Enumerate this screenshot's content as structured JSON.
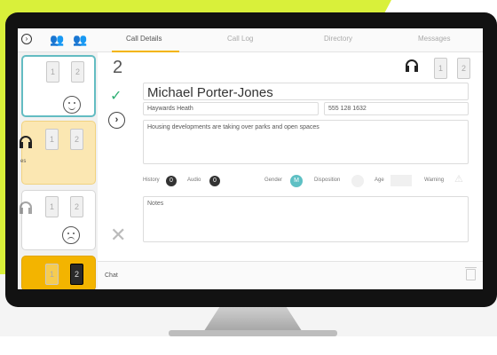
{
  "tabs": [
    {
      "label": "Call Details",
      "active": true
    },
    {
      "label": "Call Log",
      "active": false
    },
    {
      "label": "Directory",
      "active": false
    },
    {
      "label": "Messages",
      "active": false
    }
  ],
  "call": {
    "number": "2",
    "name": "Michael Porter-Jones",
    "location": "Haywards Heath",
    "phone": "555 128 1632",
    "topic": "Housing developments are taking over parks and open spaces",
    "notes_placeholder": "Notes"
  },
  "meta": {
    "history_label": "History",
    "history_count": "0",
    "audio_label": "Audio",
    "audio_count": "0",
    "gender_label": "Gender",
    "gender_value": "M",
    "disposition_label": "Disposition",
    "age_label": "Age",
    "warning_label": "Warning"
  },
  "line_lamps": [
    "1",
    "2"
  ],
  "queue": [
    {
      "lamps": [
        "1",
        "2"
      ],
      "mood": "happy",
      "color": "teal"
    },
    {
      "lamps": [
        "1",
        "2"
      ],
      "label": "es",
      "color": "yellow"
    },
    {
      "lamps": [
        "1",
        "2"
      ],
      "mood": "sad",
      "color": "white"
    },
    {
      "lamps": [
        "1",
        "2"
      ],
      "color": "orange"
    }
  ],
  "footer": {
    "chat_label": "Chat"
  },
  "colors": {
    "accent": "#f3b400",
    "teal": "#5ec0c4",
    "check": "#2eaf73",
    "background": "#d9f03a"
  }
}
